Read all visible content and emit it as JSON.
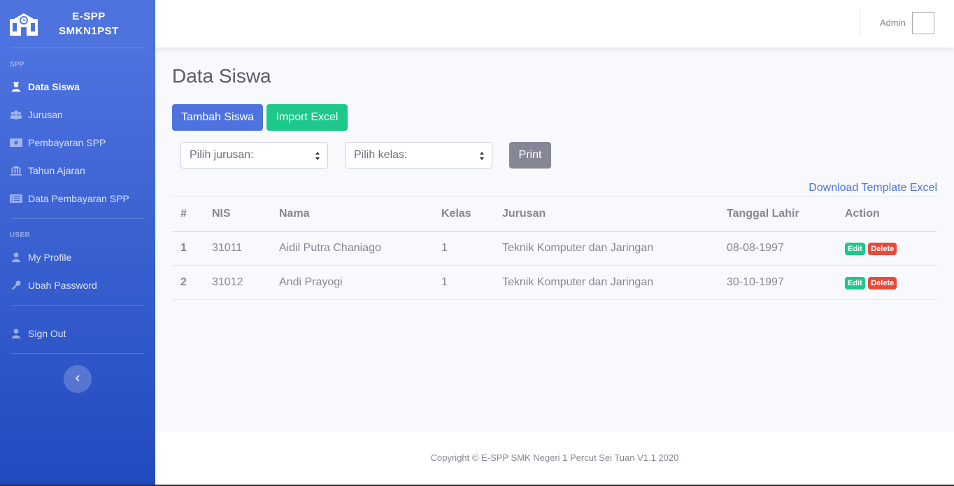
{
  "brand": {
    "line1": "E-SPP",
    "line2": "SMKN1PST",
    "icon": "school-icon"
  },
  "sidebar": {
    "heading_spp": "SPP",
    "spp_items": [
      {
        "label": "Data Siswa",
        "icon": "user-graduate-icon",
        "active": true
      },
      {
        "label": "Jurusan",
        "icon": "users-icon"
      },
      {
        "label": "Pembayaran SPP",
        "icon": "money-bill-icon"
      },
      {
        "label": "Tahun Ajaran",
        "icon": "university-icon"
      },
      {
        "label": "Data Pembayaran SPP",
        "icon": "list-alt-icon"
      }
    ],
    "heading_user": "USER",
    "user_items": [
      {
        "label": "My Profile",
        "icon": "user-icon"
      },
      {
        "label": "Ubah Password",
        "icon": "key-icon"
      }
    ],
    "signout": {
      "label": "Sign Out",
      "icon": "user-icon"
    },
    "toggle_icon": "chevron-left-icon"
  },
  "topbar": {
    "user_name": "Admin"
  },
  "main": {
    "title": "Data Siswa",
    "add_button": "Tambah Siswa",
    "import_button": "Import Excel",
    "select_jurusan": "Pilih jurusan:",
    "select_kelas": "Pilih kelas:",
    "print_button": "Print",
    "download_link": "Download Template Excel"
  },
  "table": {
    "headers": [
      "#",
      "NIS",
      "Nama",
      "Kelas",
      "Jurusan",
      "Tanggal Lahir",
      "Action"
    ],
    "rows": [
      [
        "1",
        "31011",
        "Aidil Putra Chaniago",
        "1",
        "Teknik Komputer dan Jaringan",
        "08-08-1997"
      ],
      [
        "2",
        "31012",
        "Andi Prayogi",
        "1",
        "Teknik Komputer dan Jaringan",
        "30-10-1997"
      ]
    ],
    "edit_label": "Edit",
    "delete_label": "Delete"
  },
  "footer": {
    "copyright": "Copyright © E-SPP SMK Negeri 1 Percut Sei Tuan V1.1 2020"
  },
  "colors": {
    "primary": "#4e73df",
    "success": "#1cc88a",
    "danger": "#e74a3b",
    "secondary": "#858796"
  }
}
